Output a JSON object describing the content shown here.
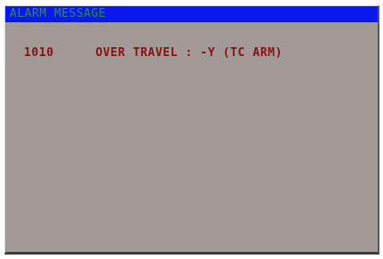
{
  "window": {
    "title": "ALARM MESSAGE"
  },
  "alarms": [
    {
      "code": "1010",
      "message": "OVER TRAVEL : -Y (TC ARM)"
    }
  ],
  "colors": {
    "title_bar": "#0a18f0",
    "title_text": "#2f8f3a",
    "panel_background": "#a19a96",
    "alarm_text": "#8b0f12"
  }
}
